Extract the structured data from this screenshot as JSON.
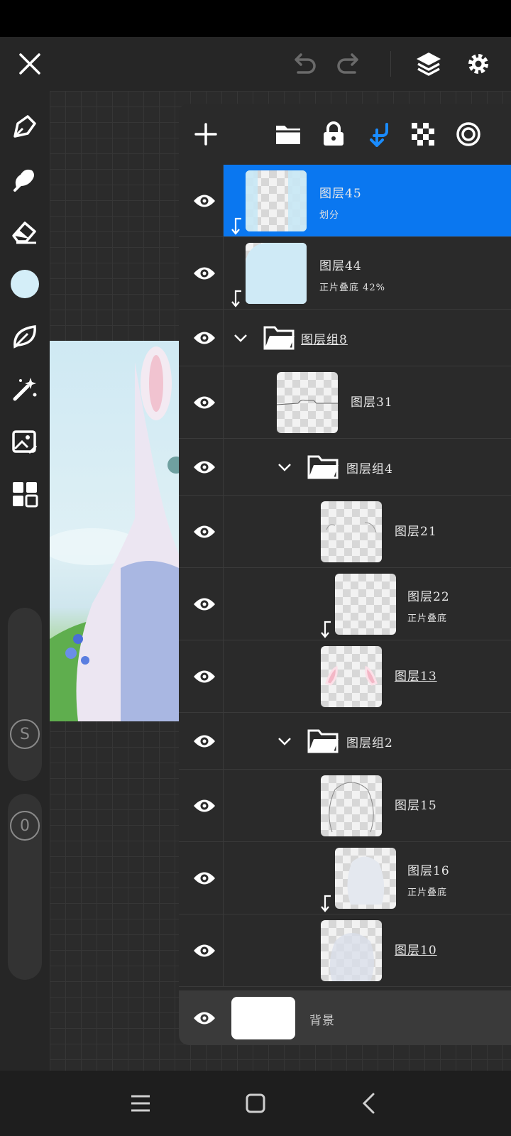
{
  "toolbar": {
    "close_icon": "close-icon",
    "undo_icon": "undo-icon",
    "redo_icon": "redo-icon",
    "layers_icon": "layers-icon",
    "settings_icon": "gear-icon"
  },
  "left_tools": {
    "items": [
      "brush-icon",
      "smudge-icon",
      "eraser-icon",
      "color-swatch",
      "leaf-icon",
      "magic-wand-icon",
      "image-edit-icon",
      "grid-icon"
    ],
    "current_color": "#d4eef8",
    "size_label": "S",
    "opacity_label": "0"
  },
  "panel": {
    "toolbar_icons": [
      "add-layer-icon",
      "folder-icon",
      "lock-icon",
      "clipping-icon",
      "transparency-icon",
      "target-icon"
    ],
    "accent": "#0a77f0"
  },
  "layers": [
    {
      "name": "图层45",
      "sub": "划分",
      "selected": true
    },
    {
      "name": "图层44",
      "sub": "正片叠底   42%"
    },
    {
      "name": "图层组8",
      "group": true
    },
    {
      "name": "图层31"
    },
    {
      "name": "图层组4",
      "group": true
    },
    {
      "name": "图层21"
    },
    {
      "name": "图层22",
      "sub": "正片叠底"
    },
    {
      "name": "图层13"
    },
    {
      "name": "图层组2",
      "group": true
    },
    {
      "name": "图层15"
    },
    {
      "name": "图层16",
      "sub": "正片叠底"
    },
    {
      "name": "图层10"
    }
  ],
  "background_layer": {
    "name": "背景"
  }
}
